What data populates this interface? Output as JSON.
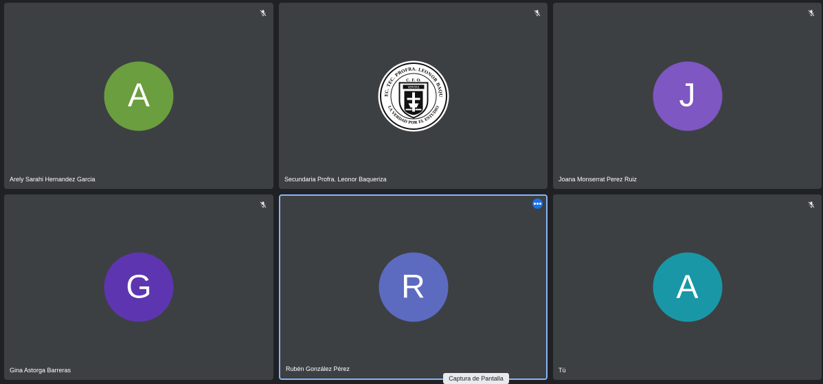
{
  "participants": [
    {
      "name": "Arely Sarahi Hernandez Garcia",
      "initial": "A",
      "avatar_color": "#6b9e3e",
      "muted": true
    },
    {
      "name": "Secundaria Profra. Leonor Baqueriza",
      "initial": "",
      "logo_text_top": "ESC. SEC. TEC. PROFRA. LEONOR BAQUERIZA",
      "logo_text_bottom": "LA VERDAD POR EL ESTUDIO",
      "logo_center": "C. F. O.",
      "logo_banner": "VERITAS",
      "muted": true
    },
    {
      "name": "Joana Monserrat Perez Ruiz",
      "initial": "J",
      "avatar_color": "#7e57c2",
      "muted": true
    },
    {
      "name": "Gina Astorga Barreras",
      "initial": "G",
      "avatar_color": "#5e35b1",
      "muted": true
    },
    {
      "name": "Rubén González Pérez",
      "initial": "R",
      "avatar_color": "#5c6bc0",
      "muted": false,
      "active": true
    },
    {
      "name": "Tú",
      "initial": "A",
      "avatar_color": "#1a97a6",
      "muted": true
    }
  ],
  "icons": {
    "mic_off": "mic-off-icon",
    "more": "more-options-icon"
  },
  "tooltip": "Captura de Pantalla",
  "colors": {
    "background": "#202124",
    "tile": "#3c4043",
    "active_border": "#8ab4f8",
    "more_button": "#1a73e8"
  }
}
